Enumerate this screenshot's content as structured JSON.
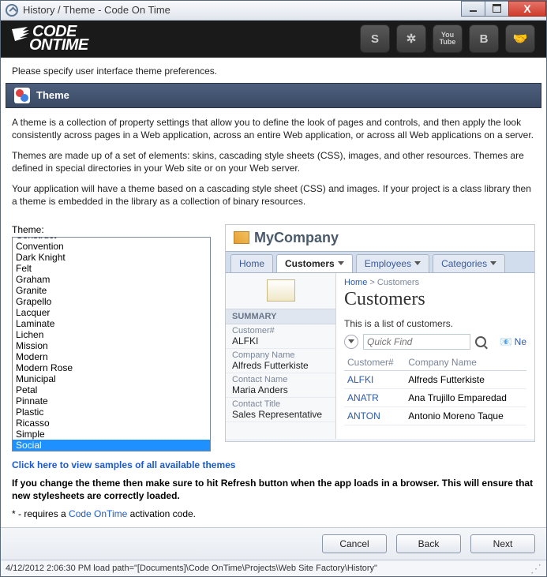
{
  "window": {
    "title": "History / Theme - Code On Time"
  },
  "logo": {
    "line1": "CODE",
    "line2": "ONTIME"
  },
  "intro": "Please specify user interface theme preferences.",
  "section": {
    "title": "Theme"
  },
  "desc": {
    "p1": "A theme is a collection of property settings that allow you to define the look of pages and controls, and then apply the look consistently across pages in a Web application, across an entire Web application, or across all Web applications on a server.",
    "p2": "Themes are made up of a set of elements: skins, cascading style sheets (CSS), images, and other resources. Themes are defined in special directories in your Web site or on your Web server.",
    "p3": "Your application will have a theme based on a cascading style sheet (CSS) and images. If your project is a class library then a theme is embedded in the library as a collection of binary resources."
  },
  "theme": {
    "label": "Theme:",
    "selected": "Social",
    "items": [
      "Construct",
      "Convention",
      "Dark Knight",
      "Felt",
      "Graham",
      "Granite",
      "Grapello",
      "Lacquer",
      "Laminate",
      "Lichen",
      "Mission",
      "Modern",
      "Modern Rose",
      "Municipal",
      "Petal",
      "Pinnate",
      "Plastic",
      "Ricasso",
      "Simple",
      "Social"
    ]
  },
  "preview": {
    "company": "MyCompany",
    "tabs": [
      "Home",
      "Customers",
      "Employees",
      "Categories"
    ],
    "active_tab": "Customers",
    "crumb_home": "Home",
    "crumb_sep": ">",
    "crumb_cur": "Customers",
    "title": "Customers",
    "sub": "This is a list of customers.",
    "quickfind": "Quick Find",
    "newlabel": "Ne",
    "summary_head": "SUMMARY",
    "fields": [
      {
        "lbl": "Customer#",
        "val": "ALFKI"
      },
      {
        "lbl": "Company Name",
        "val": "Alfreds Futterkiste"
      },
      {
        "lbl": "Contact Name",
        "val": "Maria Anders"
      },
      {
        "lbl": "Contact Title",
        "val": "Sales Representative"
      }
    ],
    "cols": [
      "Customer#",
      "Company Name"
    ],
    "rows": [
      {
        "id": "ALFKI",
        "name": "Alfreds Futterkiste"
      },
      {
        "id": "ANATR",
        "name": "Ana Trujillo Emparedad"
      },
      {
        "id": "ANTON",
        "name": "Antonio Moreno Taque"
      }
    ]
  },
  "below": {
    "link": "Click here to view samples of all available themes",
    "warn": "If you change the theme then make sure to hit Refresh button when the app loads in a browser. This will ensure that new stylesheets are correctly loaded.",
    "note_pre": "* - requires a ",
    "note_link": "Code OnTime",
    "note_post": " activation code."
  },
  "buttons": {
    "cancel": "Cancel",
    "back": "Back",
    "next": "Next"
  },
  "status": "4/12/2012 2:06:30 PM load path=\"[Documents]\\Code OnTime\\Projects\\Web Site Factory\\History\""
}
